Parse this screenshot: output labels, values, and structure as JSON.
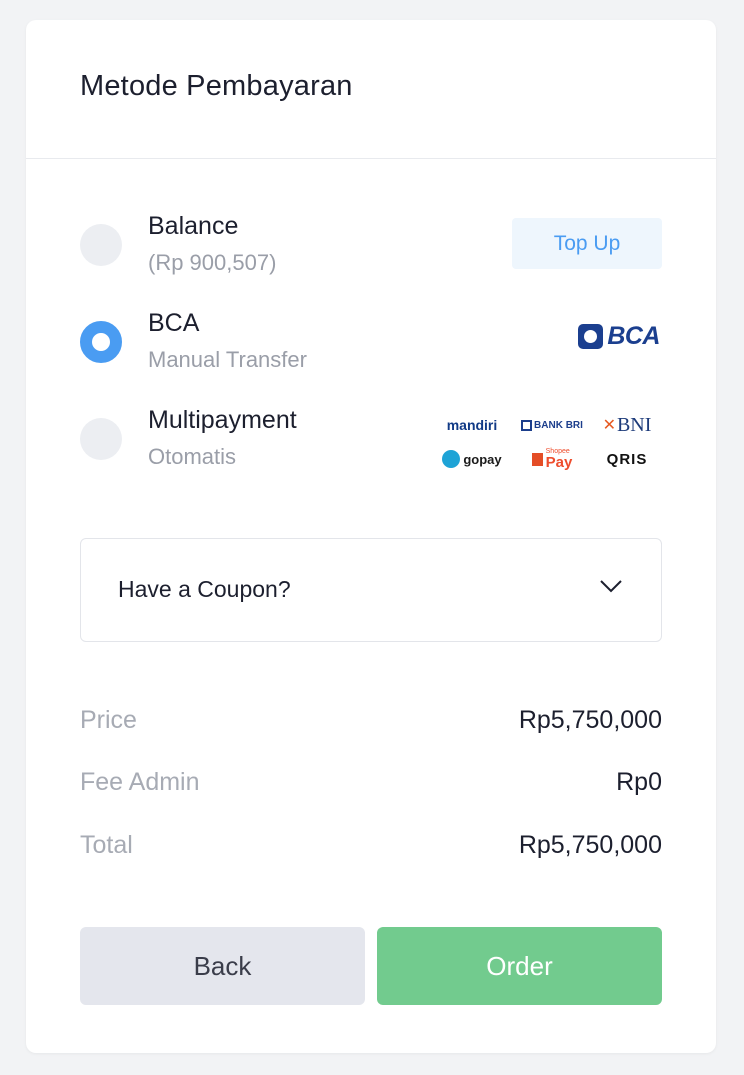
{
  "header": {
    "title": "Metode Pembayaran"
  },
  "payment_options": [
    {
      "name": "Balance",
      "subtitle": "(Rp 900,507)",
      "selected": false,
      "action_label": "Top Up"
    },
    {
      "name": "BCA",
      "subtitle": "Manual Transfer",
      "selected": true,
      "logo_text": "BCA"
    },
    {
      "name": "Multipayment",
      "subtitle": "Otomatis",
      "selected": false,
      "logos": [
        "mandiri",
        "BANK BRI",
        "BNI",
        "gopay",
        "Pay",
        "QRIS"
      ],
      "logo_small_text": "Shopee"
    }
  ],
  "coupon": {
    "label": "Have a Coupon?"
  },
  "summary": [
    {
      "label": "Price",
      "value": "Rp5,750,000"
    },
    {
      "label": "Fee Admin",
      "value": "Rp0"
    },
    {
      "label": "Total",
      "value": "Rp5,750,000"
    }
  ],
  "buttons": {
    "back": "Back",
    "order": "Order"
  },
  "colors": {
    "accent": "#4a9cf2",
    "order_button": "#72cb8e",
    "back_button": "#e4e6ed"
  }
}
